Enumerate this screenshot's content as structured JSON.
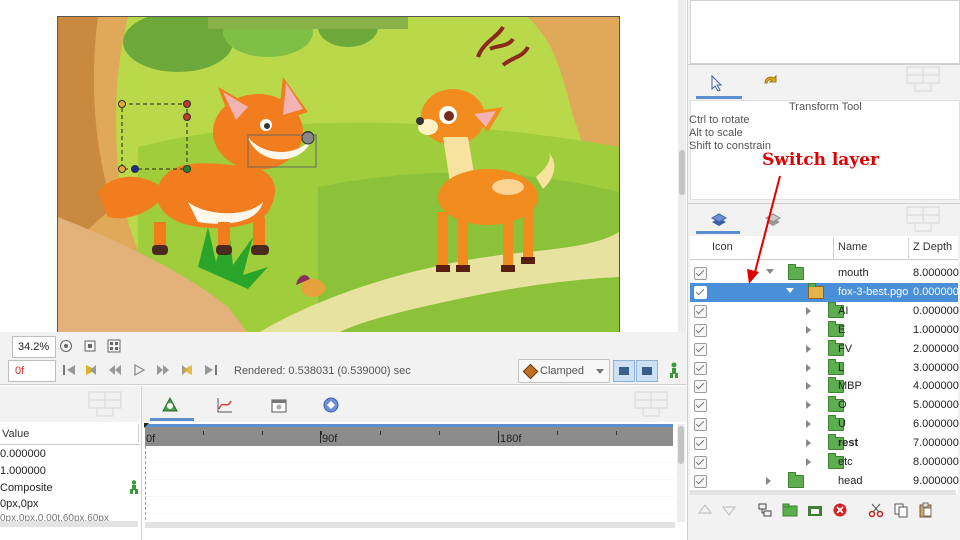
{
  "canvas": {
    "zoom": "34.2%",
    "frame": "0f",
    "rendered": "Rendered: 0.538031 (0.539000) sec",
    "interpolation": "Clamped"
  },
  "tool_panel": {
    "title": "Transform Tool",
    "hints": [
      "Ctrl to rotate",
      "Alt to scale",
      "Shift to constrain"
    ]
  },
  "annotation": {
    "text": "Switch layer",
    "color": "#e00000"
  },
  "params": {
    "header": "Value",
    "values": [
      "0.000000",
      "1.000000",
      "Composite",
      "0px,0px",
      "0px,0px,0.00t,60px,60px"
    ]
  },
  "timeline": {
    "ticks": [
      "0f",
      "90f",
      "180f"
    ]
  },
  "layers": {
    "columns": {
      "icon": "Icon",
      "name": "Name",
      "zdepth": "Z Depth"
    },
    "rows": [
      {
        "name": "mouth",
        "z": "8.000000",
        "indent": 1,
        "expanded": true,
        "selected": false,
        "bold": false,
        "kind": "folder"
      },
      {
        "name": "fox-3-best.pgo",
        "z": "0.000000",
        "indent": 2,
        "expanded": true,
        "selected": true,
        "bold": false,
        "kind": "switch"
      },
      {
        "name": "AI",
        "z": "0.000000",
        "indent": 3,
        "expanded": false,
        "selected": false,
        "bold": false,
        "kind": "folder"
      },
      {
        "name": "E",
        "z": "1.000000",
        "indent": 3,
        "expanded": false,
        "selected": false,
        "bold": false,
        "kind": "folder"
      },
      {
        "name": "FV",
        "z": "2.000000",
        "indent": 3,
        "expanded": false,
        "selected": false,
        "bold": false,
        "kind": "folder"
      },
      {
        "name": "L",
        "z": "3.000000",
        "indent": 3,
        "expanded": false,
        "selected": false,
        "bold": false,
        "kind": "folder"
      },
      {
        "name": "MBP",
        "z": "4.000000",
        "indent": 3,
        "expanded": false,
        "selected": false,
        "bold": false,
        "kind": "folder"
      },
      {
        "name": "O",
        "z": "5.000000",
        "indent": 3,
        "expanded": false,
        "selected": false,
        "bold": false,
        "kind": "folder"
      },
      {
        "name": "U",
        "z": "6.000000",
        "indent": 3,
        "expanded": false,
        "selected": false,
        "bold": false,
        "kind": "folder"
      },
      {
        "name": "rest",
        "z": "7.000000",
        "indent": 3,
        "expanded": false,
        "selected": false,
        "bold": true,
        "kind": "folder"
      },
      {
        "name": "etc",
        "z": "8.000000",
        "indent": 3,
        "expanded": false,
        "selected": false,
        "bold": false,
        "kind": "folder"
      },
      {
        "name": "head",
        "z": "9.000000",
        "indent": 1,
        "expanded": false,
        "selected": false,
        "bold": false,
        "kind": "folder"
      }
    ]
  },
  "colors": {
    "selection": "#4a90d9",
    "folder": "#5cae4f",
    "timeline_bar": "#8c8c8c",
    "timeline_accent": "#5b8fd0"
  }
}
